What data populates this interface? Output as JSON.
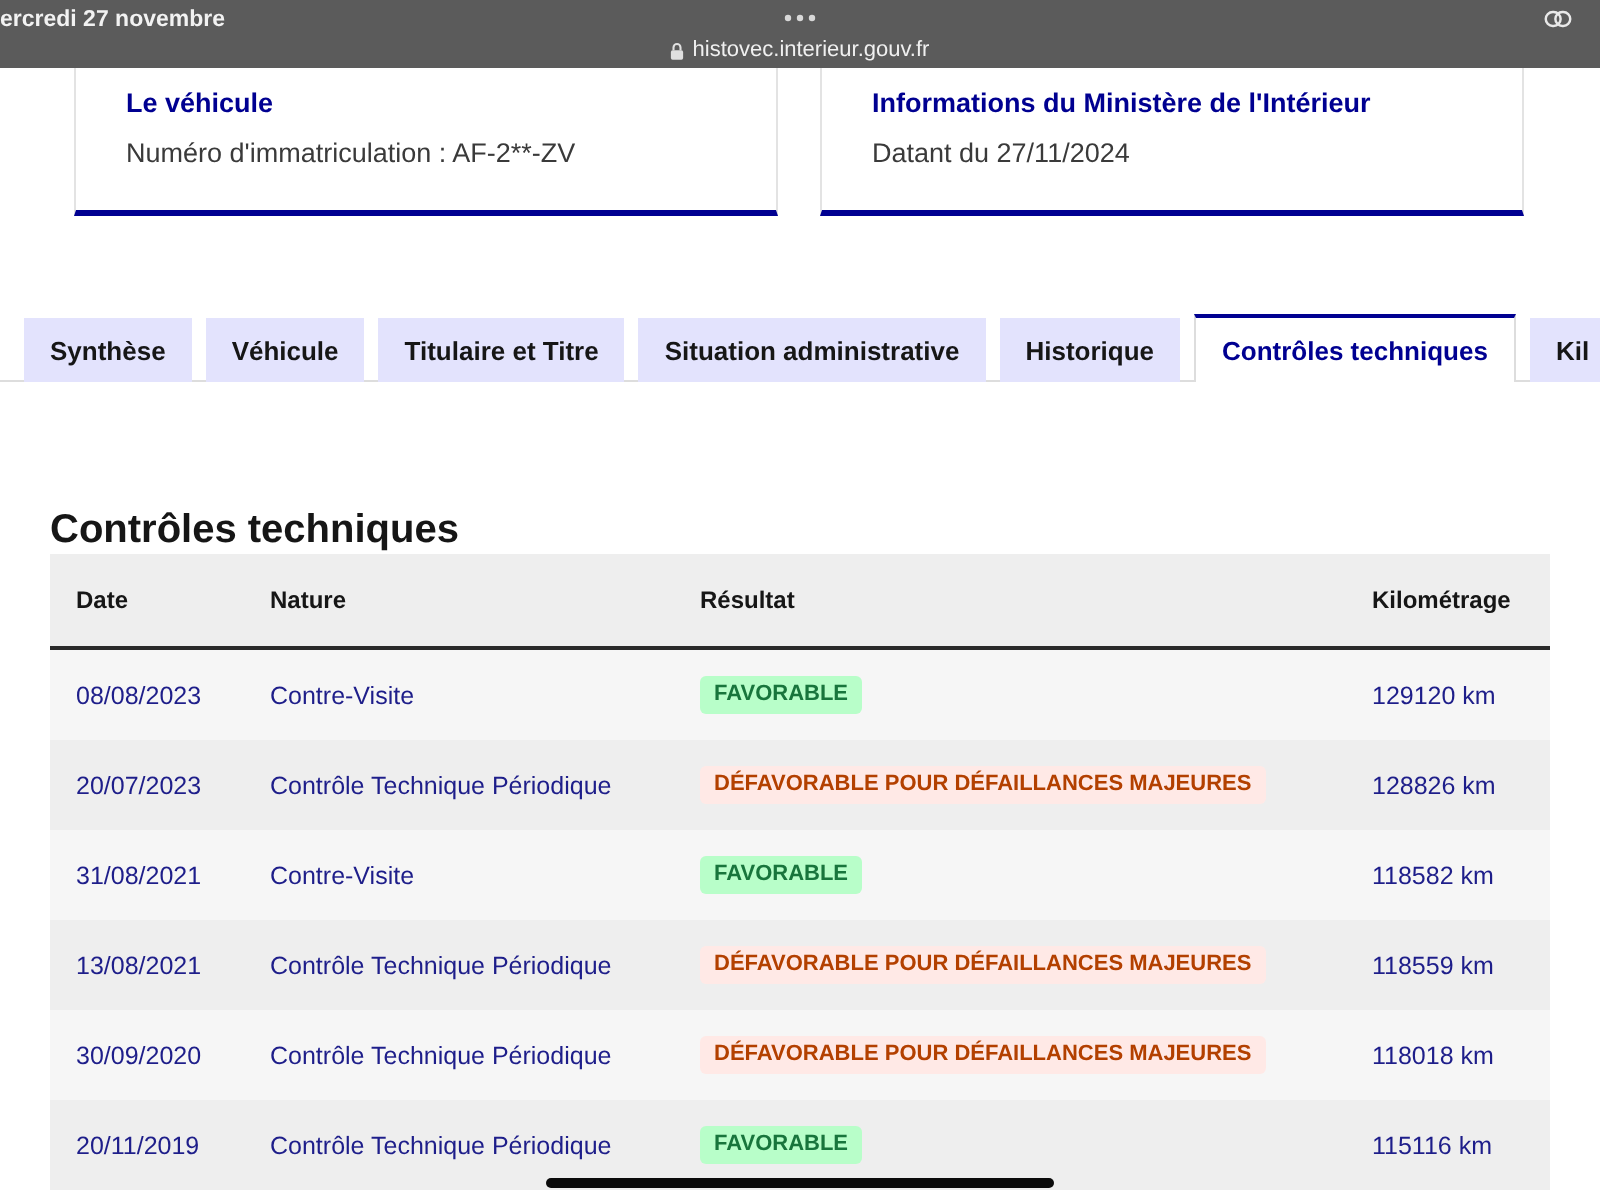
{
  "status_bar": {
    "date": "ercredi 27 novembre",
    "url": "histovec.interieur.gouv.fr"
  },
  "cards": [
    {
      "title": "Le véhicule",
      "text": "Numéro d'immatriculation : AF-2**-ZV"
    },
    {
      "title": "Informations du Ministère de l'Intérieur",
      "text": "Datant du 27/11/2024"
    }
  ],
  "tabs": [
    {
      "label": "Synthèse",
      "selected": false
    },
    {
      "label": "Véhicule",
      "selected": false
    },
    {
      "label": "Titulaire et Titre",
      "selected": false
    },
    {
      "label": "Situation administrative",
      "selected": false
    },
    {
      "label": "Historique",
      "selected": false
    },
    {
      "label": "Contrôles techniques",
      "selected": true
    },
    {
      "label": "Kil",
      "selected": false
    }
  ],
  "section": {
    "title": "Contrôles techniques"
  },
  "table": {
    "columns": [
      "Date",
      "Nature",
      "Résultat",
      "Kilométrage"
    ],
    "rows": [
      {
        "date": "08/08/2023",
        "nature": "Contre-Visite",
        "result": {
          "label": "FAVORABLE",
          "kind": "success"
        },
        "mileage": "129120 km"
      },
      {
        "date": "20/07/2023",
        "nature": "Contrôle Technique Périodique",
        "result": {
          "label": "DÉFAVORABLE POUR DÉFAILLANCES MAJEURES",
          "kind": "error"
        },
        "mileage": "128826 km"
      },
      {
        "date": "31/08/2021",
        "nature": "Contre-Visite",
        "result": {
          "label": "FAVORABLE",
          "kind": "success"
        },
        "mileage": "118582 km"
      },
      {
        "date": "13/08/2021",
        "nature": "Contrôle Technique Périodique",
        "result": {
          "label": "DÉFAVORABLE POUR DÉFAILLANCES MAJEURES",
          "kind": "error"
        },
        "mileage": "118559 km"
      },
      {
        "date": "30/09/2020",
        "nature": "Contrôle Technique Périodique",
        "result": {
          "label": "DÉFAVORABLE POUR DÉFAILLANCES MAJEURES",
          "kind": "error"
        },
        "mileage": "118018 km"
      },
      {
        "date": "20/11/2019",
        "nature": "Contrôle Technique Périodique",
        "result": {
          "label": "FAVORABLE",
          "kind": "success"
        },
        "mileage": "115116 km"
      }
    ]
  }
}
